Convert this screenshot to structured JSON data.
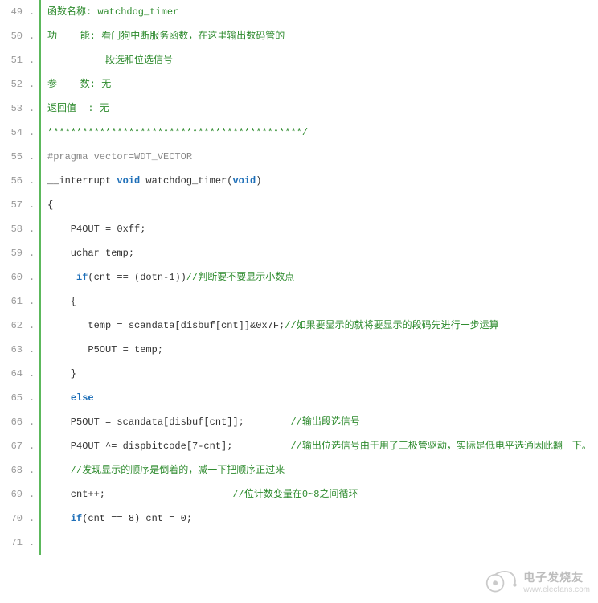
{
  "lines": [
    {
      "n": "49",
      "tokens": [
        {
          "cls": "green",
          "t": "函数名称: watchdog_timer"
        }
      ]
    },
    {
      "n": "50",
      "tokens": [
        {
          "cls": "green",
          "t": "功    能: 看门狗中断服务函数，在这里输出数码管的"
        }
      ]
    },
    {
      "n": "51",
      "tokens": [
        {
          "cls": "green",
          "t": "          段选和位选信号"
        }
      ]
    },
    {
      "n": "52",
      "tokens": [
        {
          "cls": "green",
          "t": "参    数: 无"
        }
      ]
    },
    {
      "n": "53",
      "tokens": [
        {
          "cls": "green",
          "t": "返回值  : 无"
        }
      ]
    },
    {
      "n": "54",
      "tokens": [
        {
          "cls": "green",
          "t": "********************************************/"
        }
      ]
    },
    {
      "n": "55",
      "tokens": [
        {
          "cls": "gray",
          "t": "#pragma vector=WDT_VECTOR"
        }
      ]
    },
    {
      "n": "56",
      "tokens": [
        {
          "cls": "",
          "t": "__interrupt "
        },
        {
          "cls": "keyword",
          "t": "void"
        },
        {
          "cls": "",
          "t": " watchdog_timer("
        },
        {
          "cls": "keyword",
          "t": "void"
        },
        {
          "cls": "",
          "t": ")"
        }
      ]
    },
    {
      "n": "57",
      "tokens": [
        {
          "cls": "",
          "t": "{"
        }
      ]
    },
    {
      "n": "58",
      "tokens": [
        {
          "cls": "",
          "t": "    P4OUT = 0xff;"
        }
      ]
    },
    {
      "n": "59",
      "tokens": [
        {
          "cls": "",
          "t": "    uchar temp;"
        }
      ]
    },
    {
      "n": "60",
      "tokens": [
        {
          "cls": "",
          "t": "     "
        },
        {
          "cls": "keyword",
          "t": "if"
        },
        {
          "cls": "",
          "t": "(cnt == (dotn-1))"
        },
        {
          "cls": "green",
          "t": "//判断要不要显示小数点"
        }
      ]
    },
    {
      "n": "61",
      "tokens": [
        {
          "cls": "",
          "t": "    {"
        }
      ]
    },
    {
      "n": "62",
      "tokens": [
        {
          "cls": "",
          "t": "       temp = scandata[disbuf[cnt]]&0x7F;"
        },
        {
          "cls": "green",
          "t": "//如果要显示的就将要显示的段码先进行一步运算"
        }
      ]
    },
    {
      "n": "63",
      "tokens": [
        {
          "cls": "",
          "t": "       P5OUT = temp;"
        }
      ]
    },
    {
      "n": "64",
      "tokens": [
        {
          "cls": "",
          "t": "    }"
        }
      ]
    },
    {
      "n": "65",
      "tokens": [
        {
          "cls": "",
          "t": "    "
        },
        {
          "cls": "keyword",
          "t": "else"
        }
      ]
    },
    {
      "n": "66",
      "tokens": [
        {
          "cls": "",
          "t": "    P5OUT = scandata[disbuf[cnt]];        "
        },
        {
          "cls": "green",
          "t": "//输出段选信号"
        }
      ]
    },
    {
      "n": "67",
      "tokens": [
        {
          "cls": "",
          "t": "    P4OUT ^= dispbitcode[7-cnt];          "
        },
        {
          "cls": "green",
          "t": "//输出位选信号由于用了三极管驱动，实际是低电平选通因此翻一下。"
        }
      ]
    },
    {
      "n": "68",
      "tokens": [
        {
          "cls": "",
          "t": "    "
        },
        {
          "cls": "green",
          "t": "//发现显示的顺序是倒着的，减一下把顺序正过来"
        }
      ]
    },
    {
      "n": "69",
      "tokens": [
        {
          "cls": "",
          "t": "    cnt++;                      "
        },
        {
          "cls": "green",
          "t": "//位计数变量在0~8之间循环"
        }
      ]
    },
    {
      "n": "70",
      "tokens": [
        {
          "cls": "",
          "t": "    "
        },
        {
          "cls": "keyword",
          "t": "if"
        },
        {
          "cls": "",
          "t": "(cnt == 8) cnt = 0;"
        }
      ]
    },
    {
      "n": "71",
      "tokens": [
        {
          "cls": "",
          "t": " "
        }
      ]
    }
  ],
  "watermark": {
    "cn": "电子发烧友",
    "url": "www.elecfans.com"
  }
}
